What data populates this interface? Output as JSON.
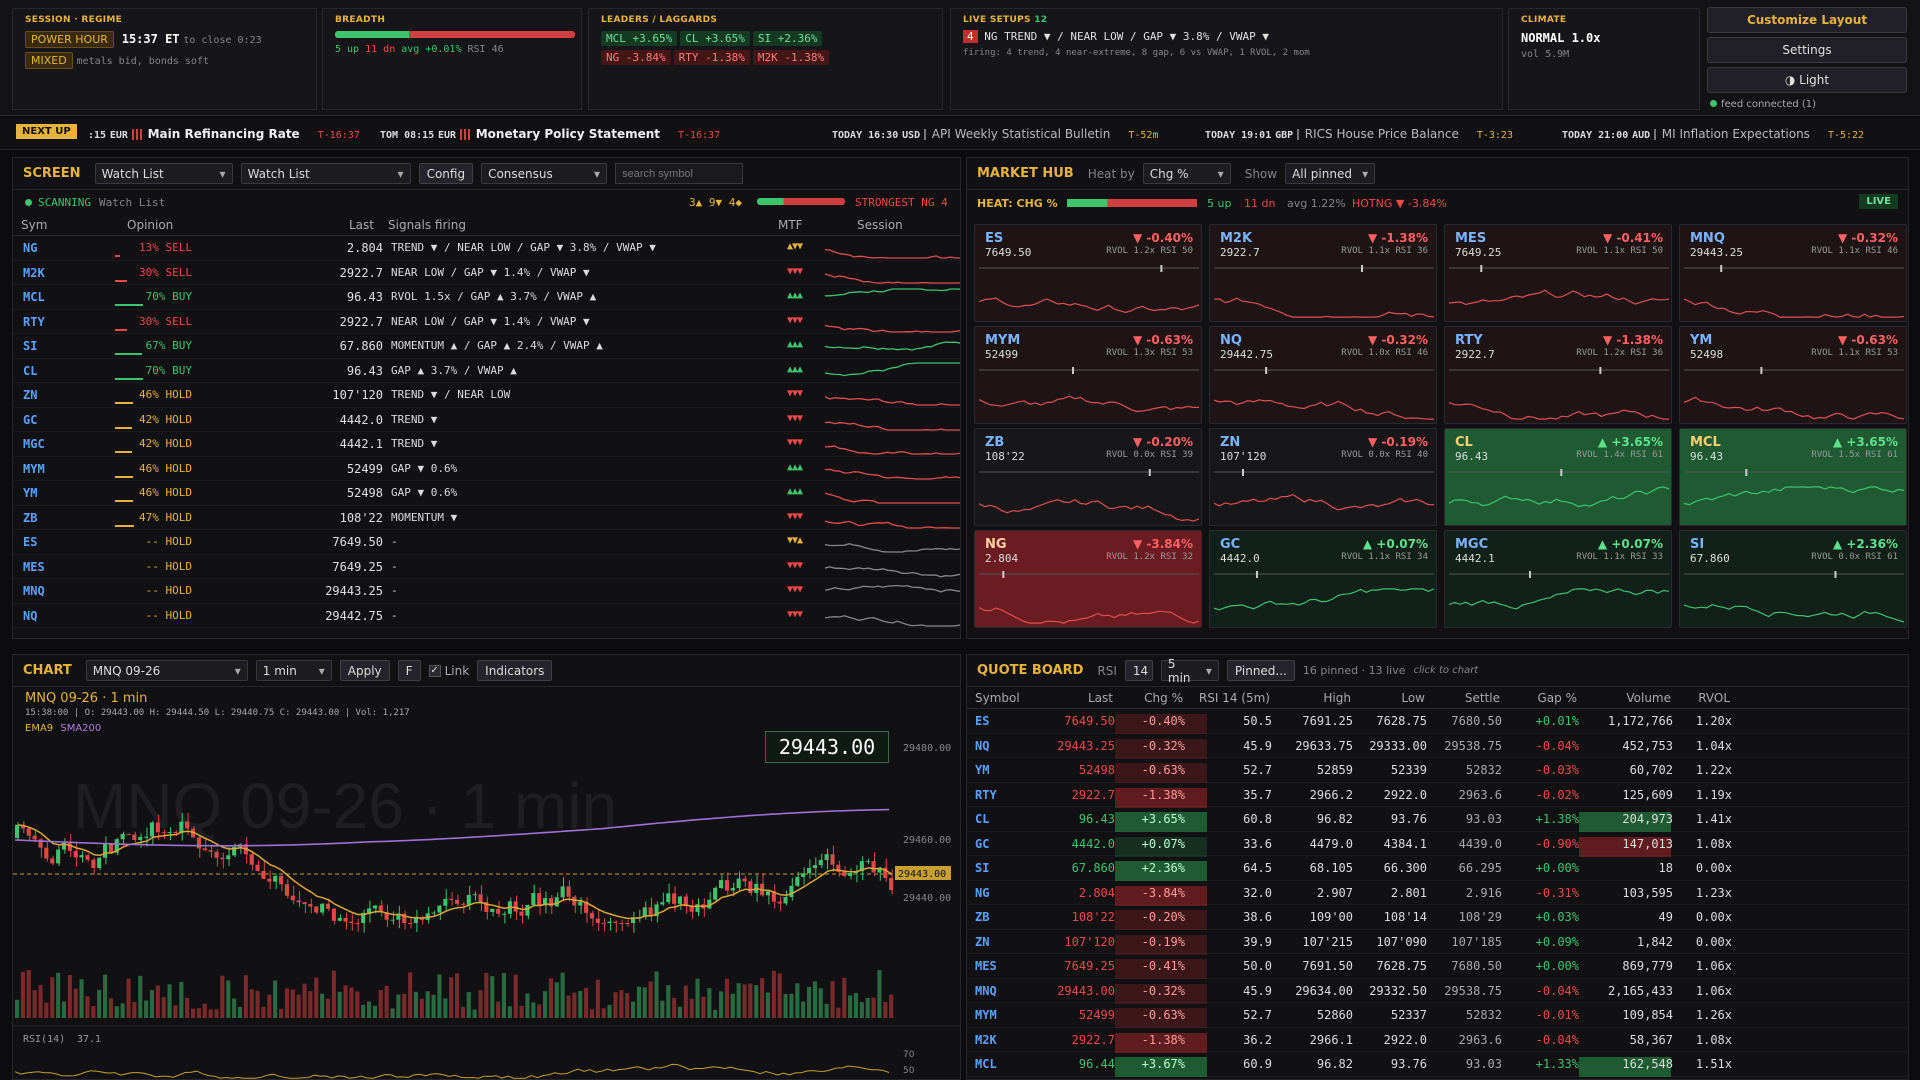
{
  "top": {
    "session": {
      "label": "SESSION · REGIME",
      "badge1": "POWER HOUR",
      "time": "15:37 ET",
      "close_note": "to close 0:23",
      "badge2": "MIXED",
      "note": "metals bid, bonds soft"
    },
    "breadth": {
      "label": "BREADTH",
      "up": "5 up",
      "dn": "11 dn",
      "avg": "avg +0.01%",
      "rsi": "RSI 46",
      "up_frac": 0.31
    },
    "leaders": {
      "label": "LEADERS / LAGGARDS",
      "row1": [
        "MCL +3.65%",
        "CL +3.65%",
        "SI +2.36%"
      ],
      "row2": [
        "NG -3.84%",
        "RTY -1.38%",
        "M2K -1.38%"
      ]
    },
    "setups": {
      "label": "LIVE SETUPS",
      "count": "12",
      "badge": "4",
      "line": "NG  TREND ▼  /  NEAR LOW  /  GAP ▼ 3.8%  /  VWAP ▼",
      "firing": "firing: 4 trend, 4 near-extreme, 8 gap, 6 vs VWAP, 1 RVOL, 2 mom"
    },
    "climate": {
      "label": "CLIMATE",
      "value": "NORMAL 1.0x",
      "vol": "vol 5.9M"
    },
    "buttons": {
      "customize": "Customize Layout",
      "settings": "Settings",
      "light": "◑ Light"
    },
    "feed": "feed connected (1)"
  },
  "ticker": {
    "next_up": "NEXT UP",
    "items": [
      {
        "time": ":15",
        "cur": "EUR",
        "name": "Main Refinancing Rate",
        "t": "T-16:37",
        "hi": true
      },
      {
        "time": "TOM 08:15",
        "cur": "EUR",
        "name": "Monetary Policy Statement",
        "t": "T-16:37",
        "hi": true
      },
      {
        "time": "TODAY 16:30",
        "cur": "USD",
        "name": "API Weekly Statistical Bulletin",
        "t": "T-52m",
        "hi": false
      },
      {
        "time": "TODAY 19:01",
        "cur": "GBP",
        "name": "RICS House Price Balance",
        "t": "T-3:23",
        "hi": false
      },
      {
        "time": "TODAY 21:00",
        "cur": "AUD",
        "name": "MI Inflation Expectations",
        "t": "T-5:22",
        "hi": false
      }
    ]
  },
  "screen": {
    "title": "SCREEN",
    "sel1": "Watch List",
    "sel2": "Watch List",
    "config": "Config",
    "sel3": "Consensus",
    "search_placeholder": "search symbol",
    "scanning": "SCANNING",
    "scan_list": "Watch List",
    "counts": "3▲ 9▼ 4◆",
    "strongest": "STRONGEST NG 4",
    "cols": {
      "sym": "Sym",
      "opinion": "Opinion",
      "last": "Last",
      "signals": "Signals firing",
      "mtf": "MTF",
      "session": "Session"
    },
    "rows": [
      {
        "sym": "NG",
        "op": "13% SELL",
        "last": "2.804",
        "sig": "TREND ▼  /  NEAR LOW  /  GAP ▼ 3.8%  /  VWAP ▼",
        "mtf": "▲▼▼",
        "trend": "dn"
      },
      {
        "sym": "M2K",
        "op": "30% SELL",
        "last": "2922.7",
        "sig": "NEAR LOW  /  GAP ▼ 1.4%  /  VWAP ▼",
        "mtf": "▼▼▼",
        "trend": "dn"
      },
      {
        "sym": "MCL",
        "op": "70% BUY",
        "last": "96.43",
        "sig": "RVOL 1.5x  /  GAP ▲ 3.7%  /  VWAP ▲",
        "mtf": "▲▲▲",
        "trend": "up"
      },
      {
        "sym": "RTY",
        "op": "30% SELL",
        "last": "2922.7",
        "sig": "NEAR LOW  /  GAP ▼ 1.4%  /  VWAP ▼",
        "mtf": "▼▼▼",
        "trend": "dn"
      },
      {
        "sym": "SI",
        "op": "67% BUY",
        "last": "67.860",
        "sig": "MOMENTUM ▲  /  GAP ▲ 2.4%  /  VWAP ▲",
        "mtf": "▲▲▲",
        "trend": "up"
      },
      {
        "sym": "CL",
        "op": "70% BUY",
        "last": "96.43",
        "sig": "GAP ▲ 3.7%  /  VWAP ▲",
        "mtf": "▲▲▲",
        "trend": "up"
      },
      {
        "sym": "ZN",
        "op": "46% HOLD",
        "last": "107'120",
        "sig": "TREND ▼  /  NEAR LOW",
        "mtf": "▼▼▼",
        "trend": "dn"
      },
      {
        "sym": "GC",
        "op": "42% HOLD",
        "last": "4442.0",
        "sig": "TREND ▼",
        "mtf": "▼▼▼",
        "trend": "dn"
      },
      {
        "sym": "MGC",
        "op": "42% HOLD",
        "last": "4442.1",
        "sig": "TREND ▼",
        "mtf": "▼▼▼",
        "trend": "dn"
      },
      {
        "sym": "MYM",
        "op": "46% HOLD",
        "last": "52499",
        "sig": "GAP ▼ 0.6%",
        "mtf": "▲▲▲",
        "trend": "dn"
      },
      {
        "sym": "YM",
        "op": "46% HOLD",
        "last": "52498",
        "sig": "GAP ▼ 0.6%",
        "mtf": "▲▲▲",
        "trend": "dn"
      },
      {
        "sym": "ZB",
        "op": "47% HOLD",
        "last": "108'22",
        "sig": "MOMENTUM ▼",
        "mtf": "▼▼▼",
        "trend": "dn"
      },
      {
        "sym": "ES",
        "op": "-- HOLD",
        "last": "7649.50",
        "sig": "-",
        "mtf": "▼▼▲",
        "trend": "flat"
      },
      {
        "sym": "MES",
        "op": "-- HOLD",
        "last": "7649.25",
        "sig": "-",
        "mtf": "▼▼▼",
        "trend": "flat"
      },
      {
        "sym": "MNQ",
        "op": "-- HOLD",
        "last": "29443.25",
        "sig": "-",
        "mtf": "▼▼▼",
        "trend": "flat"
      },
      {
        "sym": "NQ",
        "op": "-- HOLD",
        "last": "29442.75",
        "sig": "-",
        "mtf": "▼▼▼",
        "trend": "flat"
      }
    ]
  },
  "hub": {
    "title": "MARKET HUB",
    "heat_by": "Heat by",
    "heat_sel": "Chg %",
    "show": "Show",
    "show_sel": "All pinned",
    "heat_label": "HEAT: CHG %",
    "up": "5 up",
    "dn": "11 dn",
    "avg": "avg 1.22%",
    "hot": "HOTNG ▼ -3.84%",
    "live": "LIVE",
    "tiles": [
      {
        "s": "ES",
        "p": "7649.50",
        "c": "▼ -0.40%",
        "r": "RVOL 1.2x  RSI 50",
        "k": "red"
      },
      {
        "s": "M2K",
        "p": "2922.7",
        "c": "▼ -1.38%",
        "r": "RVOL 1.1x  RSI 36",
        "k": "red"
      },
      {
        "s": "MES",
        "p": "7649.25",
        "c": "▼ -0.41%",
        "r": "RVOL 1.1x  RSI 50",
        "k": "red"
      },
      {
        "s": "MNQ",
        "p": "29443.25",
        "c": "▼ -0.32%",
        "r": "RVOL 1.1x  RSI 46",
        "k": "red"
      },
      {
        "s": "MYM",
        "p": "52499",
        "c": "▼ -0.63%",
        "r": "RVOL 1.3x  RSI 53",
        "k": "red"
      },
      {
        "s": "NQ",
        "p": "29442.75",
        "c": "▼ -0.32%",
        "r": "RVOL 1.0x  RSI 46",
        "k": "red"
      },
      {
        "s": "RTY",
        "p": "2922.7",
        "c": "▼ -1.38%",
        "r": "RVOL 1.2x  RSI 36",
        "k": "red"
      },
      {
        "s": "YM",
        "p": "52498",
        "c": "▼ -0.63%",
        "r": "RVOL 1.1x  RSI 53",
        "k": "red"
      },
      {
        "s": "ZB",
        "p": "108'22",
        "c": "▼ -0.20%",
        "r": "RVOL 0.0x  RSI 39",
        "k": "neu"
      },
      {
        "s": "ZN",
        "p": "107'120",
        "c": "▼ -0.19%",
        "r": "RVOL 0.0x  RSI 40",
        "k": "neu"
      },
      {
        "s": "CL",
        "p": "96.43",
        "c": "▲ +3.65%",
        "r": "RVOL 1.4x  RSI 61",
        "k": "hotg"
      },
      {
        "s": "MCL",
        "p": "96.43",
        "c": "▲ +3.65%",
        "r": "RVOL 1.5x  RSI 61",
        "k": "hotg"
      },
      {
        "s": "NG",
        "p": "2.804",
        "c": "▼ -3.84%",
        "r": "RVOL 1.2x  RSI 32",
        "k": "hotr"
      },
      {
        "s": "GC",
        "p": "4442.0",
        "c": "▲ +0.07%",
        "r": "RVOL 1.1x  RSI 34",
        "k": "grn"
      },
      {
        "s": "MGC",
        "p": "4442.1",
        "c": "▲ +0.07%",
        "r": "RVOL 1.1x  RSI 33",
        "k": "grn"
      },
      {
        "s": "SI",
        "p": "67.860",
        "c": "▲ +2.36%",
        "r": "RVOL 0.0x  RSI 61",
        "k": "grn"
      }
    ]
  },
  "chart": {
    "title": "CHART",
    "symbol": "MNQ 09-26",
    "tf": "1 min",
    "apply": "Apply",
    "f": "F",
    "link": "Link",
    "indicators": "Indicators",
    "heading": "MNQ 09-26 · 1 min",
    "ohlc": "15:38:00  |  O: 29443.00  H: 29444.50  L: 29440.75  C: 29443.00  |  Vol: 1,217",
    "ema": "EMA9",
    "sma": "SMA200",
    "price_box": "29443.00",
    "watermark": "MNQ 09-26 · 1 min",
    "y_ticks": [
      "29480.00",
      "29460.00",
      "29440.00"
    ],
    "price_tag": "29443.00",
    "rsi_label": "RSI(14)",
    "rsi_val": "37.1",
    "rsi_ticks": [
      "70",
      "50"
    ]
  },
  "quote": {
    "title": "QUOTE BOARD",
    "rsi": "RSI",
    "rsi_val": "14",
    "tf": "5 min",
    "pinned": "Pinned...",
    "count": "16 pinned · 13 live",
    "click": "click to chart",
    "cols": [
      "Symbol",
      "Last",
      "Chg %",
      "RSI 14 (5m)",
      "High",
      "Low",
      "Settle",
      "Gap %",
      "Volume",
      "RVOL"
    ],
    "rows": [
      [
        "ES",
        "7649.50",
        "-0.40%",
        "50.5",
        "7691.25",
        "7628.75",
        "7680.50",
        "+0.01%",
        "1,172,766",
        "1.20x"
      ],
      [
        "NQ",
        "29443.25",
        "-0.32%",
        "45.9",
        "29633.75",
        "29333.00",
        "29538.75",
        "-0.04%",
        "452,753",
        "1.04x"
      ],
      [
        "YM",
        "52498",
        "-0.63%",
        "52.7",
        "52859",
        "52339",
        "52832",
        "-0.03%",
        "60,702",
        "1.22x"
      ],
      [
        "RTY",
        "2922.7",
        "-1.38%",
        "35.7",
        "2966.2",
        "2922.0",
        "2963.6",
        "-0.02%",
        "125,609",
        "1.19x"
      ],
      [
        "CL",
        "96.43",
        "+3.65%",
        "60.8",
        "96.82",
        "93.76",
        "93.03",
        "+1.38%",
        "204,973",
        "1.41x"
      ],
      [
        "GC",
        "4442.0",
        "+0.07%",
        "33.6",
        "4479.0",
        "4384.1",
        "4439.0",
        "-0.90%",
        "147,013",
        "1.08x"
      ],
      [
        "SI",
        "67.860",
        "+2.36%",
        "64.5",
        "68.105",
        "66.300",
        "66.295",
        "+0.00%",
        "18",
        "0.00x"
      ],
      [
        "NG",
        "2.804",
        "-3.84%",
        "32.0",
        "2.907",
        "2.801",
        "2.916",
        "-0.31%",
        "103,595",
        "1.23x"
      ],
      [
        "ZB",
        "108'22",
        "-0.20%",
        "38.6",
        "109'00",
        "108'14",
        "108'29",
        "+0.03%",
        "49",
        "0.00x"
      ],
      [
        "ZN",
        "107'120",
        "-0.19%",
        "39.9",
        "107'215",
        "107'090",
        "107'185",
        "+0.09%",
        "1,842",
        "0.00x"
      ],
      [
        "MES",
        "7649.25",
        "-0.41%",
        "50.0",
        "7691.50",
        "7628.75",
        "7680.50",
        "+0.00%",
        "869,779",
        "1.06x"
      ],
      [
        "MNQ",
        "29443.00",
        "-0.32%",
        "45.9",
        "29634.00",
        "29332.50",
        "29538.75",
        "-0.04%",
        "2,165,433",
        "1.06x"
      ],
      [
        "MYM",
        "52499",
        "-0.63%",
        "52.7",
        "52860",
        "52337",
        "52832",
        "-0.01%",
        "109,854",
        "1.26x"
      ],
      [
        "M2K",
        "2922.7",
        "-1.38%",
        "36.2",
        "2966.1",
        "2922.0",
        "2963.6",
        "-0.04%",
        "58,367",
        "1.08x"
      ],
      [
        "MCL",
        "96.44",
        "+3.67%",
        "60.9",
        "96.82",
        "93.76",
        "93.03",
        "+1.33%",
        "162,548",
        "1.51x"
      ]
    ]
  },
  "colors": {
    "accent": "#e6b43c",
    "up": "#3ec46d",
    "down": "#f04848",
    "link": "#5aa0ff"
  }
}
